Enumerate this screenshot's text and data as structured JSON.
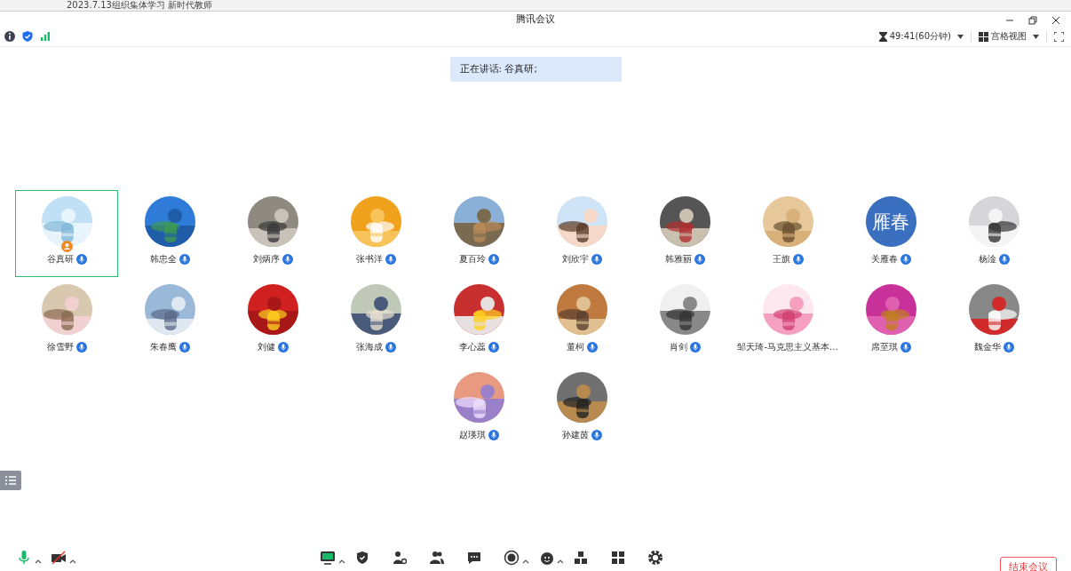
{
  "background_window": {
    "title": "2023.7.13组织集体学习 新时代教师"
  },
  "window": {
    "title": "腾讯会议"
  },
  "toolbar": {
    "timer": "49:41(60分钟)",
    "view": "宫格视图"
  },
  "speaking": "正在讲话: 谷真研;",
  "participants": [
    {
      "name": "谷真研",
      "selected": true,
      "host": true
    },
    {
      "name": "韩忠全",
      "selected": false,
      "host": false
    },
    {
      "name": "刘炳序",
      "selected": false,
      "host": false
    },
    {
      "name": "张书洋",
      "selected": false,
      "host": false
    },
    {
      "name": "夏百玲",
      "selected": false,
      "host": false
    },
    {
      "name": "刘欣宇",
      "selected": false,
      "host": false
    },
    {
      "name": "韩雅丽",
      "selected": false,
      "host": false
    },
    {
      "name": "王旗",
      "selected": false,
      "host": false
    },
    {
      "name": "关雁春",
      "kind": "text",
      "avatar_text": "雁春",
      "selected": false,
      "host": false
    },
    {
      "name": "杨淦",
      "selected": false,
      "host": false
    },
    {
      "name": "徐雪野",
      "selected": false,
      "host": false
    },
    {
      "name": "朱春鹰",
      "selected": false,
      "host": false
    },
    {
      "name": "刘健",
      "selected": false,
      "host": false
    },
    {
      "name": "张海成",
      "selected": false,
      "host": false
    },
    {
      "name": "李心蕊",
      "selected": false,
      "host": false
    },
    {
      "name": "董柯",
      "selected": false,
      "host": false
    },
    {
      "name": "肖剑",
      "selected": false,
      "host": false
    },
    {
      "name": "邹天琦-马克思主义基本...",
      "selected": false,
      "host": false,
      "mic": false
    },
    {
      "name": "席至琪",
      "selected": false,
      "host": false
    },
    {
      "name": "魏金华",
      "selected": false,
      "host": false
    },
    {
      "name": "赵瑛琪",
      "selected": false,
      "host": false
    },
    {
      "name": "孙建茵",
      "selected": false,
      "host": false
    }
  ],
  "end_button": "结束会议"
}
